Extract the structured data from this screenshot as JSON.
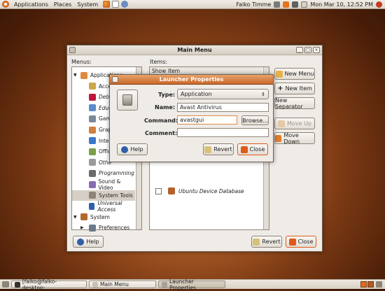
{
  "top_panel": {
    "menus": [
      "Applications",
      "Places",
      "System"
    ],
    "user": "Falko Timme",
    "datetime": "Mon Mar 10, 12:52 PM"
  },
  "main_menu": {
    "title": "Main Menu",
    "menus_label": "Menus:",
    "items_label": "Items:",
    "items_headers": [
      "Show",
      "Item"
    ],
    "tree": [
      {
        "label": "Applications",
        "icon": "applications-icon",
        "expanded": true
      },
      {
        "label": "Access",
        "icon": "accessories-icon"
      },
      {
        "label": "Debia",
        "icon": "debian-icon"
      },
      {
        "label": "Educ",
        "icon": "education-icon"
      },
      {
        "label": "Gam",
        "icon": "games-icon"
      },
      {
        "label": "Grap",
        "icon": "graphics-icon"
      },
      {
        "label": "Inter",
        "icon": "internet-icon"
      },
      {
        "label": "Offic",
        "icon": "office-icon"
      },
      {
        "label": "Othe",
        "icon": "other-icon"
      },
      {
        "label": "Programming",
        "icon": "programming-icon"
      },
      {
        "label": "Sound & Video",
        "icon": "sound-video-icon"
      },
      {
        "label": "System Tools",
        "icon": "system-tools-icon",
        "selected": true
      },
      {
        "label": "Universal Access",
        "icon": "universal-access-icon"
      },
      {
        "label": "System",
        "icon": "system-icon",
        "expanded": true
      },
      {
        "label": "Preferences",
        "icon": "preferences-icon"
      }
    ],
    "list_item": {
      "label": "Ubuntu Device Database",
      "checked": false
    },
    "buttons": {
      "new_menu": "New Menu",
      "new_item": "New Item",
      "new_separator": "New Separator",
      "move_up": "Move Up",
      "move_down": "Move Down",
      "help": "Help",
      "revert": "Revert",
      "close": "Close"
    }
  },
  "launcher_dialog": {
    "title": "Launcher Properties",
    "type_label": "Type:",
    "type_value": "Application",
    "name_label": "Name:",
    "name_value": "Avast Antivirus",
    "command_label": "Command:",
    "command_value": "avastgui",
    "browse": "Browse...",
    "comment_label": "Comment:",
    "comment_value": "",
    "help": "Help",
    "revert": "Revert",
    "close": "Close"
  },
  "taskbar": {
    "tasks": [
      "[falko@falko-desktop:...",
      "Main Menu",
      "Launcher Properties"
    ]
  }
}
